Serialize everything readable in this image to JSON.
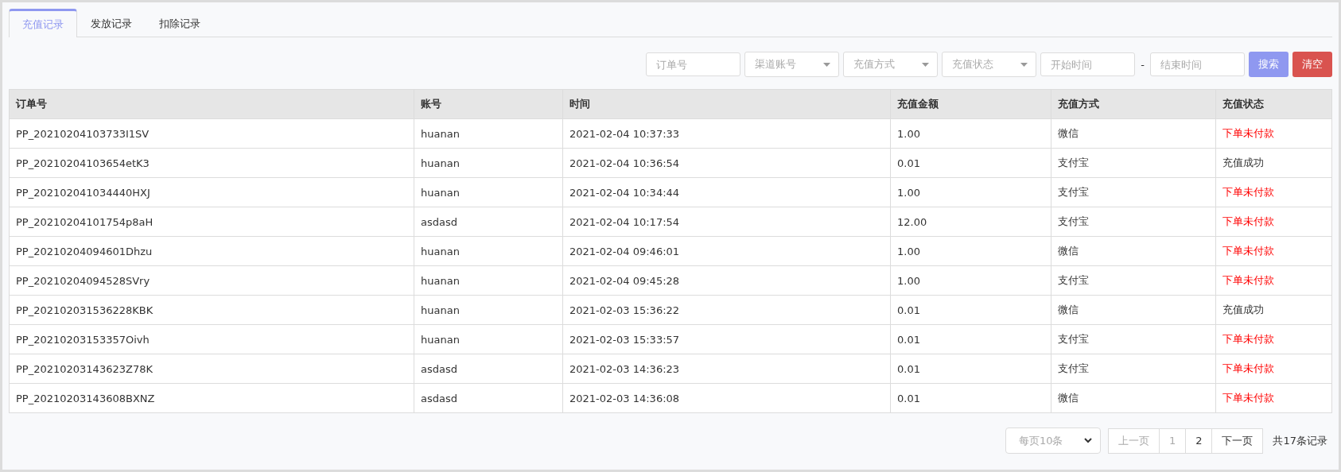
{
  "tabs": [
    {
      "label": "充值记录",
      "selected": true
    },
    {
      "label": "发放记录",
      "selected": false
    },
    {
      "label": "扣除记录",
      "selected": false
    }
  ],
  "filters": [
    {
      "kind": "input",
      "placeholder": "订单号"
    },
    {
      "kind": "select",
      "placeholder": "渠道账号"
    },
    {
      "kind": "select",
      "placeholder": "充值方式"
    },
    {
      "kind": "select",
      "placeholder": "充值状态"
    },
    {
      "kind": "input",
      "placeholder": "开始时间"
    },
    {
      "kind": "separator",
      "label": "-"
    },
    {
      "kind": "input",
      "placeholder": "结束时间"
    }
  ],
  "buttons": [
    {
      "label": "搜索",
      "kind": "primary"
    },
    {
      "label": "清空",
      "kind": "danger"
    }
  ],
  "table": {
    "columns": [
      "订单号",
      "账号",
      "时间",
      "充值金额",
      "充值方式",
      "充值状态"
    ],
    "rows": [
      {
        "order": "PP_20210204103733I1SV",
        "account": "huanan",
        "time": "2021-02-04 10:37:33",
        "amount": "1.00",
        "method": "微信",
        "status": "下单未付款",
        "kind": "unpaid"
      },
      {
        "order": "PP_20210204103654etK3",
        "account": "huanan",
        "time": "2021-02-04 10:36:54",
        "amount": "0.01",
        "method": "支付宝",
        "status": "充值成功",
        "kind": "success"
      },
      {
        "order": "PP_202102041034440HXJ",
        "account": "huanan",
        "time": "2021-02-04 10:34:44",
        "amount": "1.00",
        "method": "支付宝",
        "status": "下单未付款",
        "kind": "unpaid"
      },
      {
        "order": "PP_20210204101754p8aH",
        "account": "asdasd",
        "time": "2021-02-04 10:17:54",
        "amount": "12.00",
        "method": "支付宝",
        "status": "下单未付款",
        "kind": "unpaid"
      },
      {
        "order": "PP_20210204094601Dhzu",
        "account": "huanan",
        "time": "2021-02-04 09:46:01",
        "amount": "1.00",
        "method": "微信",
        "status": "下单未付款",
        "kind": "unpaid"
      },
      {
        "order": "PP_20210204094528SVry",
        "account": "huanan",
        "time": "2021-02-04 09:45:28",
        "amount": "1.00",
        "method": "支付宝",
        "status": "下单未付款",
        "kind": "unpaid"
      },
      {
        "order": "PP_202102031536228KBK",
        "account": "huanan",
        "time": "2021-02-03 15:36:22",
        "amount": "0.01",
        "method": "微信",
        "status": "充值成功",
        "kind": "success"
      },
      {
        "order": "PP_20210203153357Oivh",
        "account": "huanan",
        "time": "2021-02-03 15:33:57",
        "amount": "0.01",
        "method": "支付宝",
        "status": "下单未付款",
        "kind": "unpaid"
      },
      {
        "order": "PP_20210203143623Z78K",
        "account": "asdasd",
        "time": "2021-02-03 14:36:23",
        "amount": "0.01",
        "method": "支付宝",
        "status": "下单未付款",
        "kind": "unpaid"
      },
      {
        "order": "PP_20210203143608BXNZ",
        "account": "asdasd",
        "time": "2021-02-03 14:36:08",
        "amount": "0.01",
        "method": "微信",
        "status": "下单未付款",
        "kind": "unpaid"
      }
    ]
  },
  "pagination": {
    "page_size": "每页10条",
    "prev": {
      "label": "上一页",
      "disabled": true
    },
    "pages": [
      {
        "label": "1",
        "selected": true
      },
      {
        "label": "2",
        "selected": false
      }
    ],
    "next": {
      "label": "下一页",
      "disabled": false
    },
    "total": "共17条记录"
  }
}
